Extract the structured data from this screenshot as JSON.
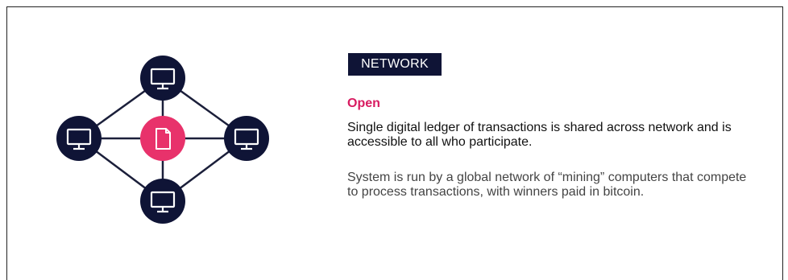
{
  "tag": "NETWORK",
  "heading": "Open",
  "lead": "Single digital ledger of transactions is shared across network and is accessible to all who participate.",
  "body": "System is run by a global network of “mining” computers that compete to process transactions, with winners paid in bitcoin.",
  "colors": {
    "node": "#0f1436",
    "center": "#e8326b",
    "tag_bg": "#0f1436",
    "heading": "#d81b60",
    "line": "#1b1f3a"
  },
  "icons": {
    "nodes": "computer-monitor-icon",
    "center": "document-icon"
  }
}
